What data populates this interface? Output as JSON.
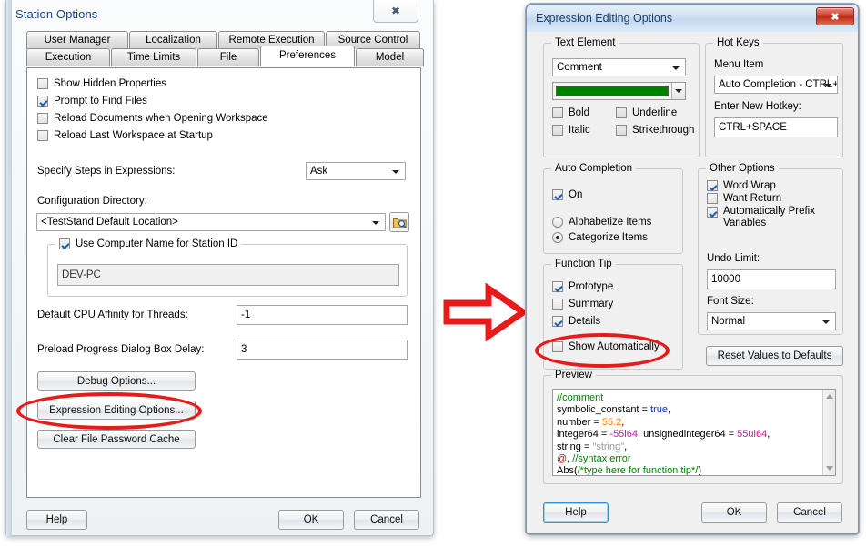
{
  "left_dialog": {
    "title": "Station Options",
    "close_icon": "close-icon",
    "tabs_row1": [
      "User Manager",
      "Localization",
      "Remote Execution",
      "Source Control"
    ],
    "tabs_row2": [
      "Execution",
      "Time Limits",
      "File",
      "Preferences",
      "Model"
    ],
    "active_tab": "Preferences",
    "checkboxes": [
      {
        "label": "Show Hidden Properties",
        "checked": false
      },
      {
        "label": "Prompt to Find Files",
        "checked": true
      },
      {
        "label": "Reload Documents when Opening Workspace",
        "checked": false
      },
      {
        "label": "Reload Last Workspace at Startup",
        "checked": false
      }
    ],
    "specify_steps_label": "Specify Steps in Expressions:",
    "specify_steps_value": "Ask",
    "config_dir_label": "Configuration Directory:",
    "config_dir_value": "<TestStand Default Location>",
    "browse_icon": "folder-browse-icon",
    "station_group": {
      "caption": "Use Computer Name for Station ID",
      "checked": true,
      "value": "DEV-PC"
    },
    "cpu_affinity_label": "Default CPU Affinity for Threads:",
    "cpu_affinity_value": "-1",
    "preload_label": "Preload Progress Dialog Box Delay:",
    "preload_value": "3",
    "buttons": {
      "debug": "Debug Options...",
      "expression": "Expression Editing Options...",
      "clear_cache": "Clear File Password Cache"
    },
    "footer": {
      "help": "Help",
      "ok": "OK",
      "cancel": "Cancel"
    }
  },
  "right_dialog": {
    "title": "Expression Editing Options",
    "close_icon": "close-icon",
    "text_element": {
      "caption": "Text Element",
      "selected": "Comment",
      "color_swatch": "#008000",
      "options": [
        {
          "label": "Bold",
          "checked": false
        },
        {
          "label": "Underline",
          "checked": false
        },
        {
          "label": "Italic",
          "checked": false
        },
        {
          "label": "Strikethrough",
          "checked": false
        }
      ]
    },
    "hot_keys": {
      "caption": "Hot Keys",
      "menu_item_label": "Menu Item",
      "menu_item_value": "Auto Completion - CTRL+",
      "hotkey_label": "Enter New Hotkey:",
      "hotkey_value": "CTRL+SPACE"
    },
    "auto_completion": {
      "caption": "Auto Completion",
      "on_label": "On",
      "on_checked": true,
      "radios": [
        {
          "label": "Alphabetize Items",
          "selected": false
        },
        {
          "label": "Categorize Items",
          "selected": true
        }
      ]
    },
    "function_tip": {
      "caption": "Function Tip",
      "items": [
        {
          "label": "Prototype",
          "checked": true
        },
        {
          "label": "Summary",
          "checked": false
        },
        {
          "label": "Details",
          "checked": true
        }
      ],
      "show_automatically": {
        "label": "Show Automatically",
        "checked": false
      }
    },
    "other_options": {
      "caption": "Other Options",
      "items": [
        {
          "label": "Word Wrap",
          "checked": true
        },
        {
          "label": "Want Return",
          "checked": false
        },
        {
          "label": "Automatically Prefix Variables",
          "checked": true
        }
      ],
      "undo_limit_label": "Undo Limit:",
      "undo_limit_value": "10000",
      "font_size_label": "Font Size:",
      "font_size_value": "Normal"
    },
    "reset_button": "Reset Values to Defaults",
    "preview": {
      "caption": "Preview",
      "lines": [
        "//comment",
        "symbolic_constant = true,",
        "number = 55.2,",
        "integer64 = -55i64, unsignedinteger64 = 55ui64,",
        "string = \"string\",",
        "@, //syntax error",
        "Abs(/*type here for function tip*/)"
      ],
      "scroll_up_icon": "scroll-up-icon",
      "scroll_down_icon": "scroll-down-icon"
    },
    "footer": {
      "help": "Help",
      "ok": "OK",
      "cancel": "Cancel"
    }
  },
  "annotations": {
    "arrow_color": "#e81b1b",
    "highlight_color": "#e81b1b",
    "arrow_icon": "right-arrow-annotation"
  }
}
